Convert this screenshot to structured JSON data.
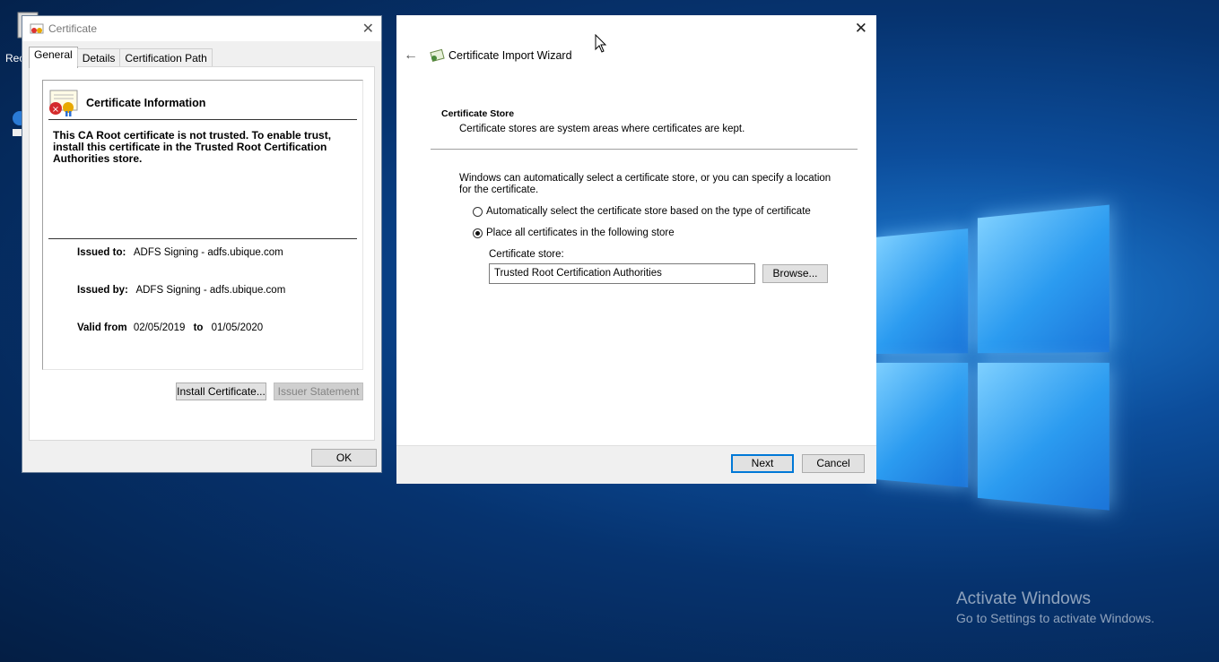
{
  "desktop": {
    "icon_label": "Rec",
    "activate_title": "Activate Windows",
    "activate_sub": "Go to Settings to activate Windows."
  },
  "certificate_dialog": {
    "title": "Certificate",
    "tabs": [
      "General",
      "Details",
      "Certification Path"
    ],
    "active_tab": "General",
    "info_title": "Certificate Information",
    "warning": "This CA Root certificate is not trusted. To enable trust, install this certificate in the Trusted Root Certification Authorities store.",
    "issued_to_label": "Issued to:",
    "issued_to": "ADFS Signing - adfs.ubique.com",
    "issued_by_label": "Issued by:",
    "issued_by": "ADFS Signing - adfs.ubique.com",
    "valid_from_label": "Valid from",
    "valid_from": "02/05/2019",
    "to_label": "to",
    "valid_to": "01/05/2020",
    "install_button": "Install Certificate...",
    "issuer_button": "Issuer Statement",
    "ok_button": "OK"
  },
  "wizard": {
    "title": "Certificate Import Wizard",
    "section_title": "Certificate Store",
    "section_sub": "Certificate stores are system areas where certificates are kept.",
    "description": "Windows can automatically select a certificate store, or you can specify a location for the certificate.",
    "option_auto": "Automatically select the certificate store based on the type of certificate",
    "option_manual": "Place all certificates in the following store",
    "selected_option": "manual",
    "store_label": "Certificate store:",
    "store_value": "Trusted Root Certification Authorities",
    "browse_button": "Browse...",
    "next_button": "Next",
    "cancel_button": "Cancel"
  },
  "colors": {
    "accent": "#0078d7",
    "desktop_bg": "#06336f"
  }
}
